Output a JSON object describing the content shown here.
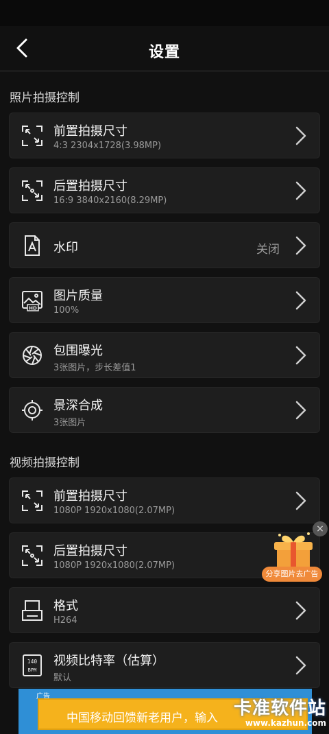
{
  "header": {
    "title": "设置"
  },
  "sections": [
    {
      "title": "照片拍摄控制",
      "items": [
        {
          "label": "前置拍摄尺寸",
          "sub": "4:3  2304x1728(3.98MP)",
          "icon": "front-resize-icon"
        },
        {
          "label": "后置拍摄尺寸",
          "sub": "16:9  3840x2160(8.29MP)",
          "icon": "rear-resize-icon"
        },
        {
          "label": "水印",
          "value": "关闭",
          "icon": "watermark-icon"
        },
        {
          "label": "图片质量",
          "sub": "100%",
          "icon": "hd-image-icon"
        },
        {
          "label": "包围曝光",
          "sub": "3张图片，步长差值1",
          "icon": "aperture-icon"
        },
        {
          "label": "景深合成",
          "sub": "3张图片",
          "icon": "focus-target-icon"
        }
      ]
    },
    {
      "title": "视频拍摄控制",
      "items": [
        {
          "label": "前置拍摄尺寸",
          "sub": "1080P  1920x1080(2.07MP)",
          "icon": "front-resize-icon"
        },
        {
          "label": "后置拍摄尺寸",
          "sub": "1080P  1920x1080(2.07MP)",
          "icon": "rear-resize-icon"
        },
        {
          "label": "格式",
          "sub": "H264",
          "icon": "format-icon"
        },
        {
          "label": "视频比特率（估算）",
          "sub": "默认",
          "icon": "bpm-icon"
        }
      ]
    }
  ],
  "ad": {
    "share_label": "分享图片去广告",
    "close": "×"
  },
  "banner": {
    "tag": "广告",
    "text": "中国移动回馈新老用户，输入"
  },
  "watermark": {
    "main": "卡准软件站",
    "url": "www.kazhun.com"
  },
  "colors": {
    "background": "#111111",
    "card": "#1e1e1e",
    "accent": "#f08a3a"
  }
}
